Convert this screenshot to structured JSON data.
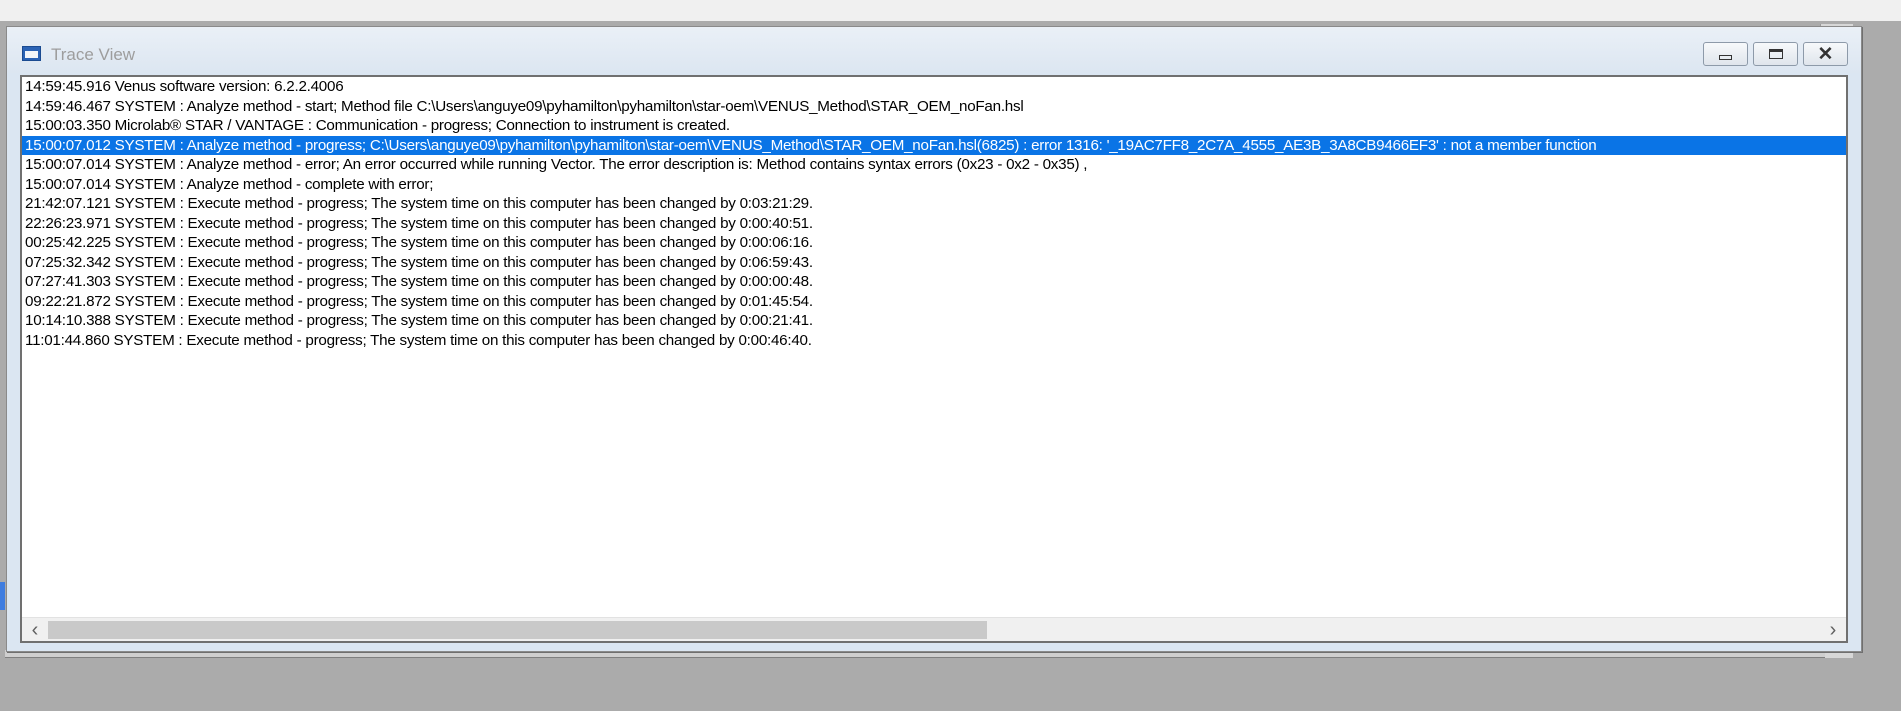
{
  "window": {
    "title": "Trace View",
    "accent_color": "#0a74e6"
  },
  "caption_buttons": {
    "minimize_icon": "minimize-icon",
    "maximize_icon": "restore-icon",
    "close_icon": "close-icon",
    "close_glyph": "✕"
  },
  "log": {
    "selected_index": 3,
    "lines": [
      "14:59:45.916 Venus software version: 6.2.2.4006",
      "14:59:46.467 SYSTEM : Analyze method - start; Method file C:\\Users\\anguye09\\pyhamilton\\pyhamilton\\star-oem\\VENUS_Method\\STAR_OEM_noFan.hsl",
      "15:00:03.350 Microlab® STAR / VANTAGE : Communication - progress; Connection to instrument is created.",
      "15:00:07.012 SYSTEM : Analyze method - progress; C:\\Users\\anguye09\\pyhamilton\\pyhamilton\\star-oem\\VENUS_Method\\STAR_OEM_noFan.hsl(6825) : error 1316: '_19AC7FF8_2C7A_4555_AE3B_3A8CB9466EF3' : not a member function",
      "15:00:07.014 SYSTEM : Analyze method - error; An error occurred while running Vector.  The error description is: Method contains syntax errors (0x23 - 0x2 - 0x35) ,",
      "15:00:07.014 SYSTEM : Analyze method - complete with error;",
      "21:42:07.121 SYSTEM : Execute method - progress; The system time on this computer has been changed by 0:03:21:29.",
      "22:26:23.971 SYSTEM : Execute method - progress; The system time on this computer has been changed by 0:00:40:51.",
      "00:25:42.225 SYSTEM : Execute method - progress; The system time on this computer has been changed by 0:00:06:16.",
      "07:25:32.342 SYSTEM : Execute method - progress; The system time on this computer has been changed by 0:06:59:43.",
      "07:27:41.303 SYSTEM : Execute method - progress; The system time on this computer has been changed by 0:00:00:48.",
      "09:22:21.872 SYSTEM : Execute method - progress; The system time on this computer has been changed by 0:01:45:54.",
      "10:14:10.388 SYSTEM : Execute method - progress; The system time on this computer has been changed by 0:00:21:41.",
      "11:01:44.860 SYSTEM : Execute method - progress; The system time on this computer has been changed by 0:00:46:40."
    ]
  },
  "scrollbar": {
    "left_glyph": "‹",
    "right_glyph": "›",
    "thumb_fraction": 0.53
  }
}
